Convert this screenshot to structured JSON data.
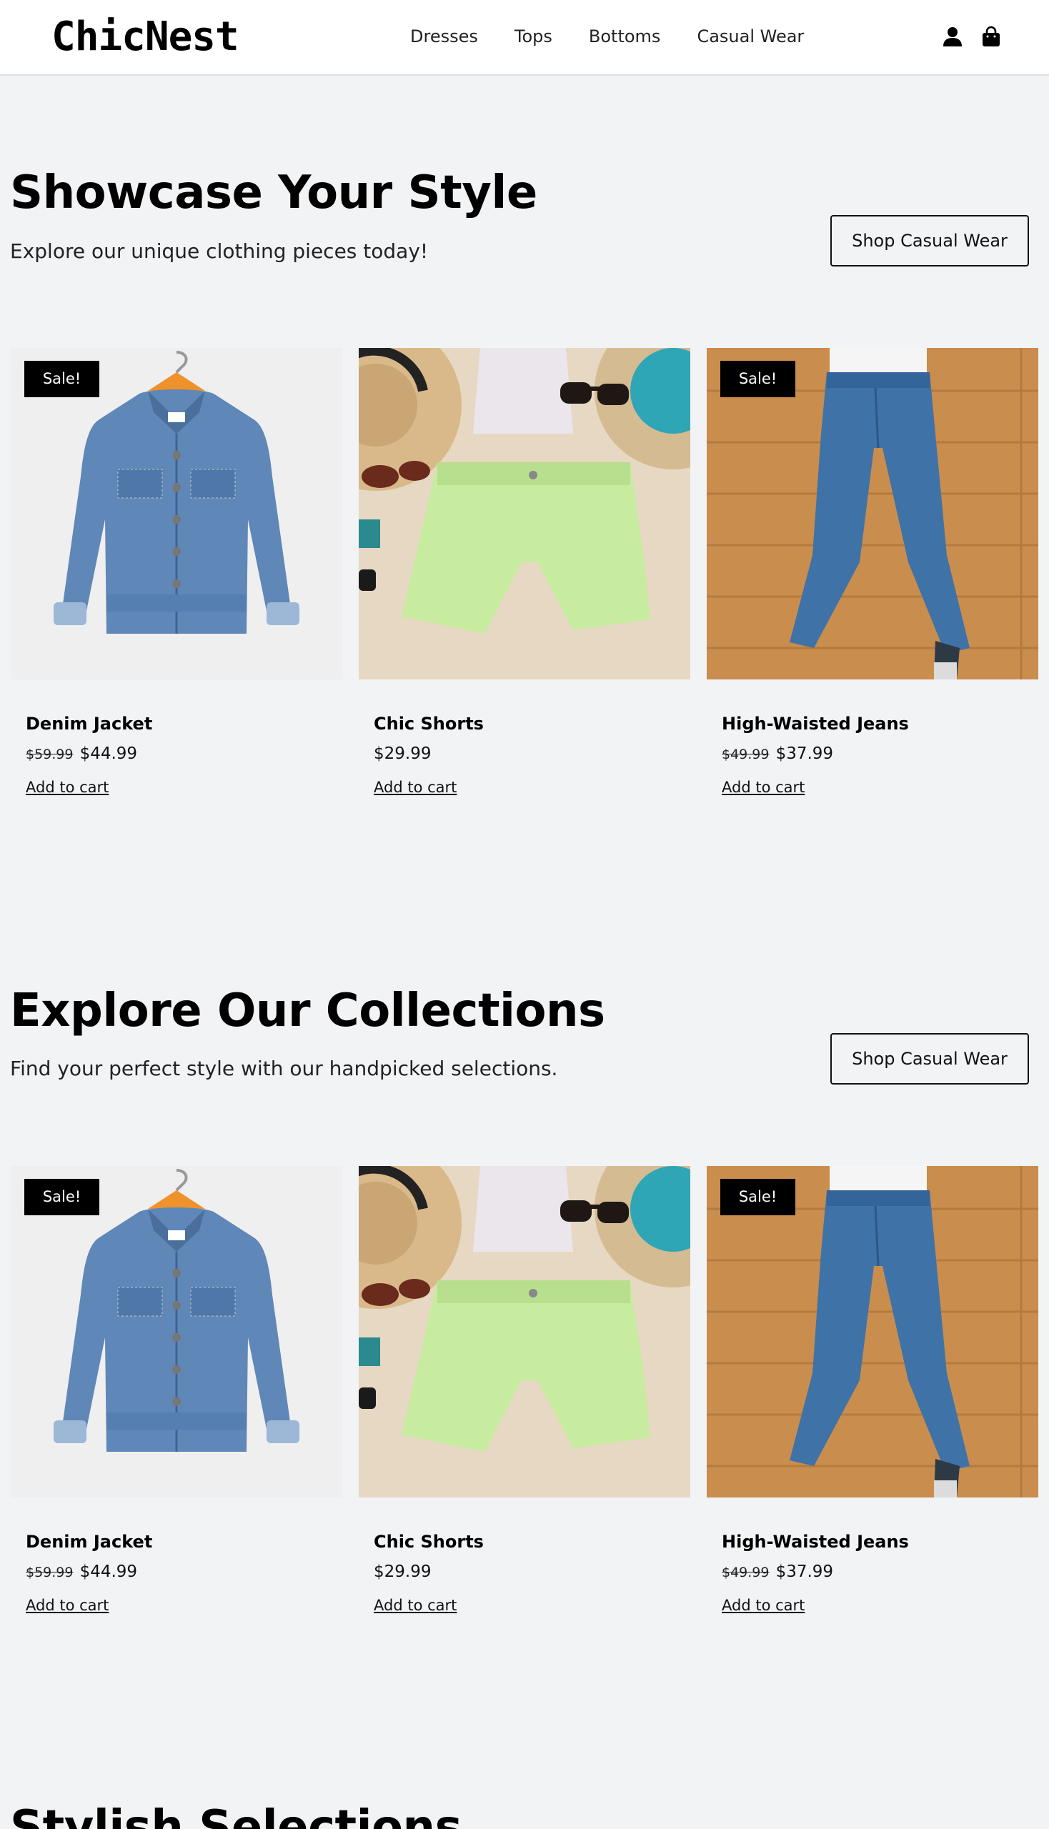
{
  "brand": {
    "logo": "ChicNest"
  },
  "nav": {
    "items": [
      "Dresses",
      "Tops",
      "Bottoms",
      "Casual Wear"
    ]
  },
  "header_icons": [
    "user-icon",
    "shopping-bag-icon"
  ],
  "sections": [
    {
      "title": "Showcase Your Style",
      "subtitle": "Explore our unique clothing pieces today!",
      "cta": "Shop Casual Wear",
      "products": [
        {
          "badge": "Sale!",
          "name": "Denim Jacket",
          "old_price": "$59.99",
          "price": "$44.99",
          "action": "Add to cart",
          "image": "denim-jacket"
        },
        {
          "badge": "",
          "name": "Chic Shorts",
          "old_price": "",
          "price": "$29.99",
          "action": "Add to cart",
          "image": "chic-shorts"
        },
        {
          "badge": "Sale!",
          "name": "High-Waisted Jeans",
          "old_price": "$49.99",
          "price": "$37.99",
          "action": "Add to cart",
          "image": "high-waisted-jeans"
        }
      ]
    },
    {
      "title": "Explore Our Collections",
      "subtitle": "Find your perfect style with our handpicked selections.",
      "cta": "Shop Casual Wear",
      "products": [
        {
          "badge": "Sale!",
          "name": "Denim Jacket",
          "old_price": "$59.99",
          "price": "$44.99",
          "action": "Add to cart",
          "image": "denim-jacket"
        },
        {
          "badge": "",
          "name": "Chic Shorts",
          "old_price": "",
          "price": "$29.99",
          "action": "Add to cart",
          "image": "chic-shorts"
        },
        {
          "badge": "Sale!",
          "name": "High-Waisted Jeans",
          "old_price": "$49.99",
          "price": "$37.99",
          "action": "Add to cart",
          "image": "high-waisted-jeans"
        }
      ]
    },
    {
      "title": "Stylish Selections"
    }
  ],
  "colors": {
    "page_bg": "#f2f3f5",
    "header_bg": "#ffffff",
    "badge_bg": "#000000",
    "text": "#111111"
  }
}
